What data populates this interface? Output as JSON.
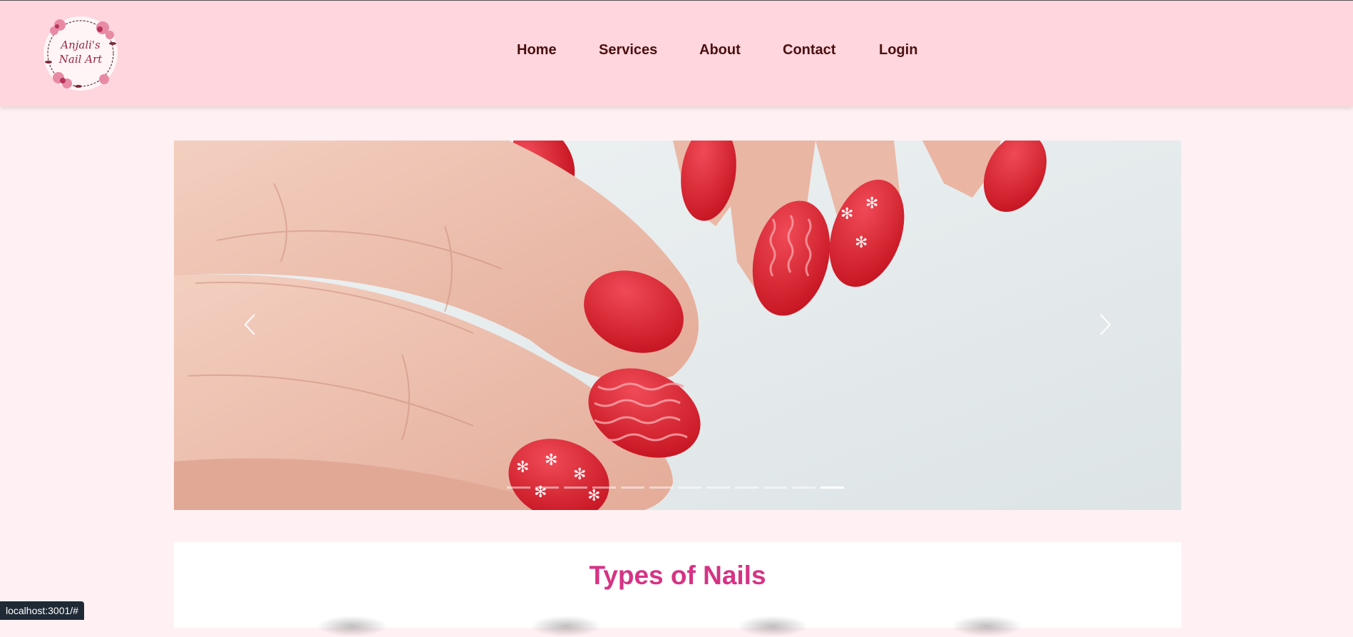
{
  "header": {
    "logo_line1": "Anjali's",
    "logo_line2": "Nail Art",
    "nav": [
      "Home",
      "Services",
      "About",
      "Contact",
      "Login"
    ]
  },
  "carousel": {
    "slide_count": 12,
    "active_slide": 12,
    "prev_icon": "chevron-left-icon",
    "next_icon": "chevron-right-icon"
  },
  "section": {
    "title": "Types of Nails"
  },
  "status_bar": {
    "url": "localhost:3001/#"
  },
  "colors": {
    "header_bg": "#ffd6dd",
    "page_bg": "#fff1f3",
    "nav_text": "#4a1010",
    "title": "#d63384",
    "nail_red": "#d91f2e"
  }
}
